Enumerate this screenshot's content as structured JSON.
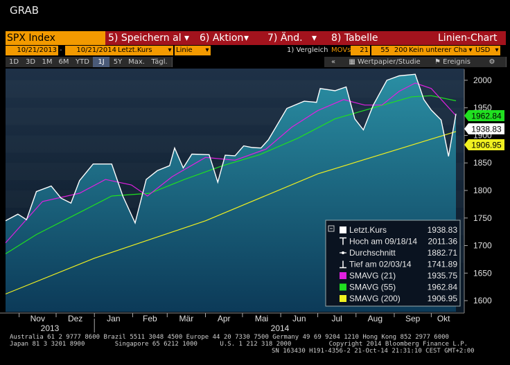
{
  "screen_title": "GRAB",
  "toolbar": {
    "ticker": "SPX Index",
    "save": "5) Speichern al",
    "action": "6) Aktion",
    "change": "7) Änd.",
    "table": "8) Tabelle",
    "chart_type": "Linien-Chart"
  },
  "controls": {
    "start_date": "10/21/2013",
    "dash": "-",
    "end_date": "10/21/2014",
    "field": "Letzt.Kurs",
    "style": "Linie",
    "compare": "1) Vergleich",
    "movs": "MOVs",
    "mov1": "21",
    "mov2": "55",
    "mov3": "200",
    "lower": "Kein unterer Cha",
    "currency": "USD"
  },
  "periods": [
    "1D",
    "3D",
    "1M",
    "6M",
    "YTD",
    "1J",
    "5Y",
    "Max.",
    "Tägl."
  ],
  "active_period": "1J",
  "extra_tabs": {
    "collapse": "«",
    "security": "Wertpapier/Studie",
    "events": "Ereignis",
    "settings": "⚙"
  },
  "colors": {
    "price": "#ffffff",
    "sma21": "#e020e0",
    "sma55": "#20e020",
    "sma200": "#f0f020",
    "area": "#1c6e8a",
    "background_top": "#1e3147"
  },
  "chart_data": {
    "type": "line",
    "ylim": [
      1580,
      2020
    ],
    "yticks": [
      2000,
      1950,
      1900,
      1850,
      1800,
      1750,
      1700,
      1650,
      1600
    ],
    "xlabels": [
      "Nov",
      "Dez",
      "Jan",
      "Feb",
      "Mär",
      "Apr",
      "Mai",
      "Jun",
      "Jul",
      "Aug",
      "Sep",
      "Okt"
    ],
    "year_labels": [
      "2013",
      "2014"
    ],
    "grid": false,
    "legend_position": "bottom-right",
    "series": [
      {
        "name": "Letzt.Kurs",
        "color": "#ffffff",
        "x": [
          "2013-10-21",
          "2013-10-31",
          "2013-11-07",
          "2013-11-15",
          "2013-11-27",
          "2013-12-05",
          "2013-12-13",
          "2013-12-20",
          "2013-12-31",
          "2014-01-15",
          "2014-01-24",
          "2014-02-03",
          "2014-02-12",
          "2014-02-21",
          "2014-03-03",
          "2014-03-07",
          "2014-03-14",
          "2014-03-21",
          "2014-04-04",
          "2014-04-11",
          "2014-04-17",
          "2014-04-25",
          "2014-05-02",
          "2014-05-09",
          "2014-05-16",
          "2014-05-22",
          "2014-06-06",
          "2014-06-20",
          "2014-06-30",
          "2014-07-03",
          "2014-07-15",
          "2014-07-24",
          "2014-07-31",
          "2014-08-07",
          "2014-08-15",
          "2014-08-26",
          "2014-09-05",
          "2014-09-18",
          "2014-09-25",
          "2014-10-01",
          "2014-10-09",
          "2014-10-15",
          "2014-10-21"
        ],
        "values": [
          1745,
          1757,
          1747,
          1798,
          1808,
          1786,
          1777,
          1818,
          1848,
          1848,
          1790,
          1741,
          1820,
          1836,
          1845,
          1877,
          1841,
          1866,
          1865,
          1815,
          1864,
          1863,
          1881,
          1878,
          1877,
          1892,
          1949,
          1962,
          1960,
          1985,
          1981,
          1988,
          1930,
          1910,
          1955,
          2000,
          2008,
          2011,
          1965,
          1946,
          1928,
          1862,
          1939
        ]
      },
      {
        "name": "SMAVG (21)",
        "color": "#e020e0",
        "x": [
          "2013-10-21",
          "2013-11-20",
          "2013-12-20",
          "2014-01-10",
          "2014-01-31",
          "2014-02-13",
          "2014-03-05",
          "2014-04-01",
          "2014-04-25",
          "2014-05-20",
          "2014-06-10",
          "2014-07-01",
          "2014-07-22",
          "2014-08-08",
          "2014-08-22",
          "2014-09-05",
          "2014-09-18",
          "2014-10-01",
          "2014-10-21"
        ],
        "values": [
          1705,
          1780,
          1795,
          1820,
          1810,
          1790,
          1825,
          1860,
          1855,
          1875,
          1915,
          1945,
          1965,
          1955,
          1955,
          1980,
          1995,
          1985,
          1935.75
        ]
      },
      {
        "name": "SMAVG (55)",
        "color": "#20e020",
        "x": [
          "2013-10-21",
          "2013-11-15",
          "2013-12-20",
          "2014-01-15",
          "2014-02-15",
          "2014-03-15",
          "2014-04-15",
          "2014-05-15",
          "2014-06-15",
          "2014-07-15",
          "2014-08-15",
          "2014-09-15",
          "2014-10-01",
          "2014-10-21"
        ],
        "values": [
          1685,
          1720,
          1760,
          1790,
          1795,
          1820,
          1845,
          1865,
          1895,
          1930,
          1950,
          1970,
          1972,
          1962.84
        ]
      },
      {
        "name": "SMAVG (200)",
        "color": "#f0f020",
        "x": [
          "2013-10-21",
          "2014-01-01",
          "2014-04-01",
          "2014-07-01",
          "2014-10-21"
        ],
        "values": [
          1612,
          1677,
          1745,
          1830,
          1906.95
        ]
      }
    ],
    "last_values": [
      {
        "label": "1962.84",
        "value": 1962.84,
        "bg": "#20e020",
        "fg": "#000000"
      },
      {
        "label": "1938.83",
        "value": 1938.83,
        "bg": "#ffffff",
        "fg": "#000000"
      },
      {
        "label": "1906.95",
        "value": 1906.95,
        "bg": "#f0f020",
        "fg": "#000000"
      }
    ]
  },
  "legend": [
    {
      "icon": "square",
      "color": "#ffffff",
      "label": "Letzt.Kurs",
      "value": "1938.83"
    },
    {
      "icon": "high-marker",
      "color": "#ffffff",
      "label": "Hoch am 09/18/14",
      "value": "2011.36"
    },
    {
      "icon": "avg-marker",
      "color": "#ffffff",
      "label": "Durchschnitt",
      "value": "1882.71"
    },
    {
      "icon": "low-marker",
      "color": "#ffffff",
      "label": "Tief am 02/03/14",
      "value": "1741.89"
    },
    {
      "icon": "square",
      "color": "#e020e0",
      "label": "SMAVG (21)",
      "value": "1935.75"
    },
    {
      "icon": "square",
      "color": "#20e020",
      "label": "SMAVG (55)",
      "value": "1962.84"
    },
    {
      "icon": "square",
      "color": "#f0f020",
      "label": "SMAVG (200)",
      "value": "1906.95"
    }
  ],
  "footer": {
    "line1": "Australia 61 2 9777 8600 Brazil 5511 3048 4500 Europe 44 20 7330 7500 Germany 49 69 9204 1210 Hong Kong 852 2977 6000",
    "line2": "Japan 81 3 3201 8900        Singapore 65 6212 1000      U.S. 1 212 318 2000          Copyright 2014 Bloomberg Finance L.P.",
    "line3": "SN 163430 H191-4356-2 21-Oct-14 21:31:10 CEST GMT+2:00"
  }
}
